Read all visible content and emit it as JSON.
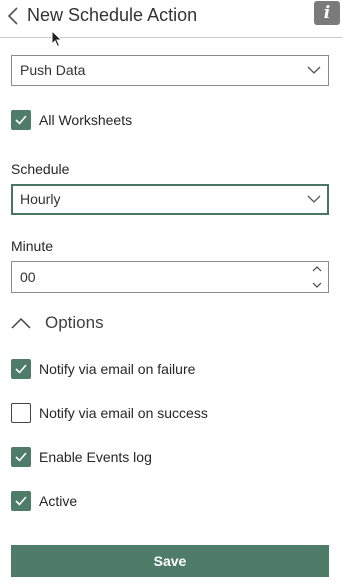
{
  "header": {
    "title": "New Schedule Action",
    "info_label": "i"
  },
  "action_select": {
    "value": "Push Data"
  },
  "all_worksheets": {
    "label": "All Worksheets",
    "checked": true
  },
  "schedule": {
    "label": "Schedule",
    "value": "Hourly"
  },
  "minute": {
    "label": "Minute",
    "value": "00"
  },
  "options": {
    "label": "Options",
    "notify_failure": {
      "label": "Notify via email on failure",
      "checked": true
    },
    "notify_success": {
      "label": "Notify via email on success",
      "checked": false
    },
    "events_log": {
      "label": "Enable Events log",
      "checked": true
    },
    "active": {
      "label": "Active",
      "checked": true
    }
  },
  "save_label": "Save",
  "colors": {
    "accent": "#4f7b69",
    "info_button": "#7a7a7a"
  }
}
